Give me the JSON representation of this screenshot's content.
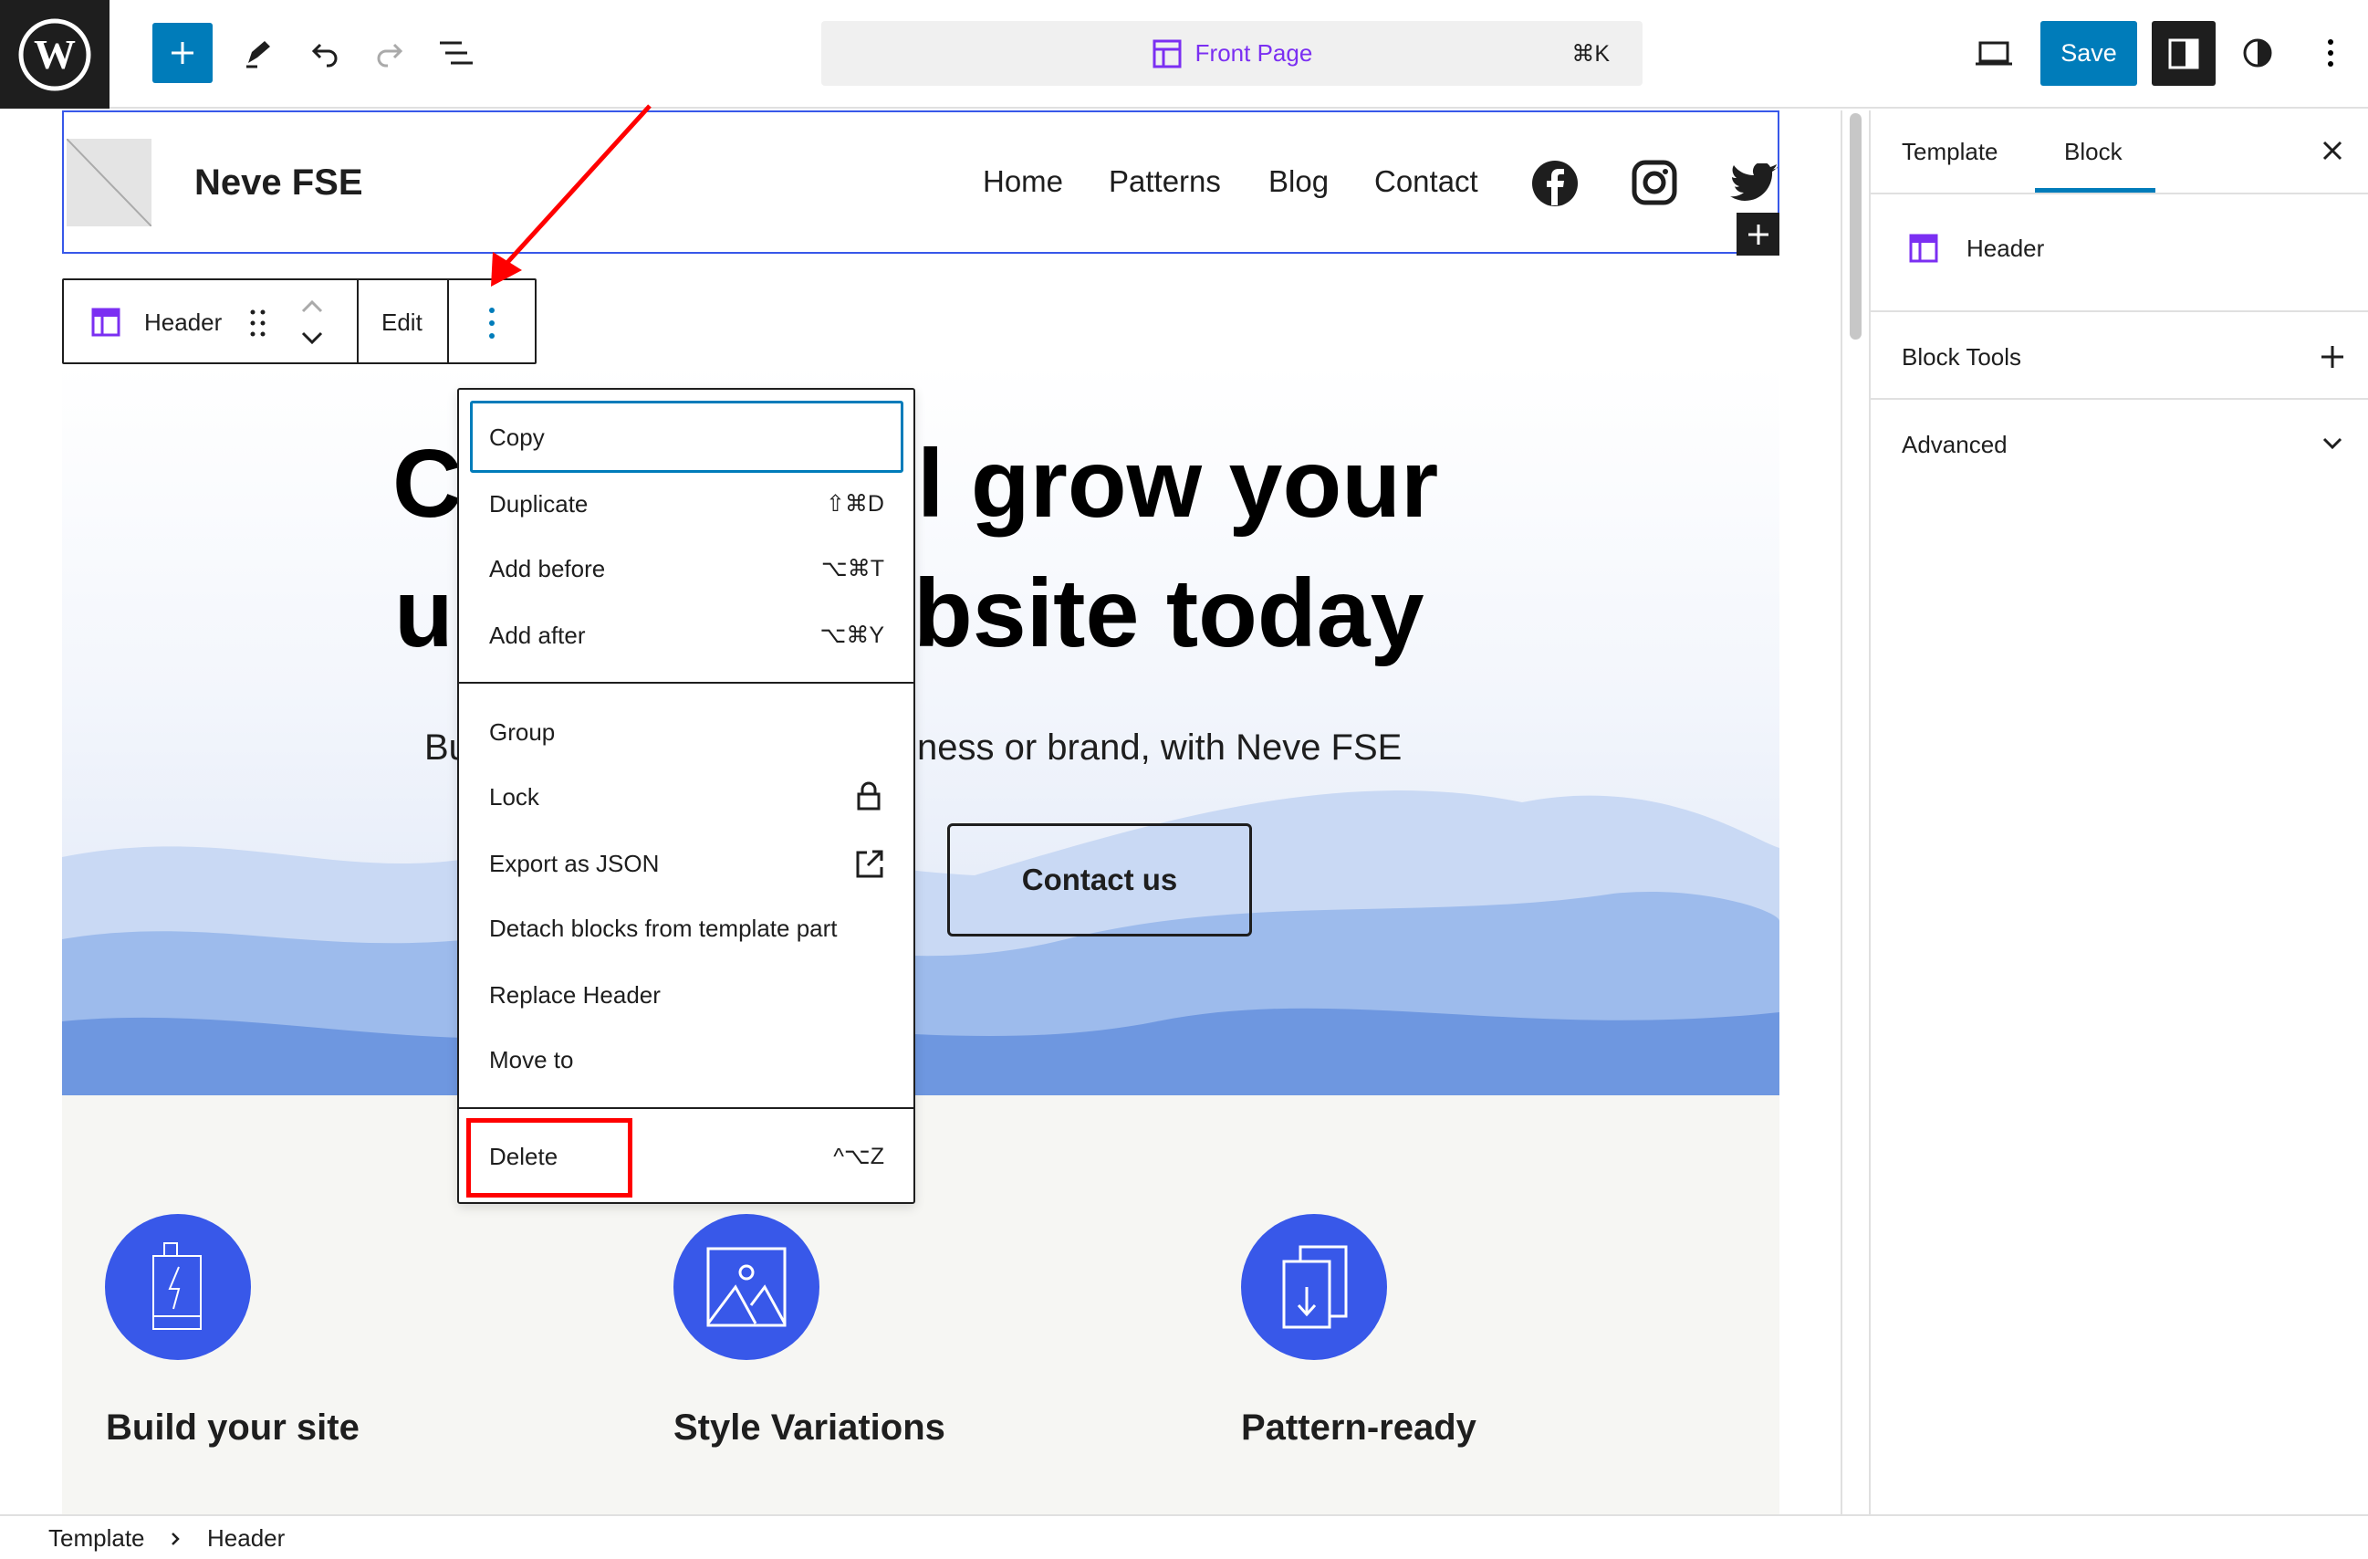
{
  "topbar": {
    "command_title": "Front Page",
    "command_shortcut": "⌘K",
    "save_label": "Save"
  },
  "header_block": {
    "site_title": "Neve FSE",
    "nav": [
      "Home",
      "Patterns",
      "Blog",
      "Contact"
    ],
    "social": [
      "facebook-icon",
      "instagram-icon",
      "twitter-icon"
    ]
  },
  "block_toolbar": {
    "block_name": "Header",
    "edit_label": "Edit"
  },
  "hero": {
    "heading_line1_left": "C",
    "heading_line1_right": "l grow your",
    "heading_line2_left": "u",
    "heading_line2_right": "bsite today",
    "subtitle_left": "Bu",
    "subtitle_right": "ness or brand, with Neve FSE",
    "button": "Contact us"
  },
  "menu": {
    "items": [
      {
        "label": "Copy"
      },
      {
        "label": "Duplicate",
        "shortcut": "⇧⌘D"
      },
      {
        "label": "Add before",
        "shortcut": "⌥⌘T"
      },
      {
        "label": "Add after",
        "shortcut": "⌥⌘Y"
      },
      {
        "label": "Group"
      },
      {
        "label": "Lock",
        "icon": "lock-icon"
      },
      {
        "label": "Export as JSON",
        "icon": "external-icon"
      },
      {
        "label": "Detach blocks from template part"
      },
      {
        "label": "Replace Header"
      },
      {
        "label": "Move to"
      },
      {
        "label": "Delete",
        "shortcut": "^⌥Z"
      }
    ]
  },
  "features": [
    {
      "title": "Build your site",
      "icon": "battery-icon"
    },
    {
      "title": "Style Variations",
      "icon": "image-icon"
    },
    {
      "title": "Pattern-ready",
      "icon": "download-doc-icon"
    }
  ],
  "sidebar": {
    "tabs": [
      "Template",
      "Block"
    ],
    "active_tab": "Block",
    "block_title": "Header",
    "sections": [
      "Block Tools",
      "Advanced"
    ]
  },
  "breadcrumb": [
    "Template",
    "Header"
  ],
  "colors": {
    "accent": "#007cba",
    "feature": "#3858e9",
    "highlight": "#ff0000",
    "template_icon": "#7b2ff2"
  }
}
